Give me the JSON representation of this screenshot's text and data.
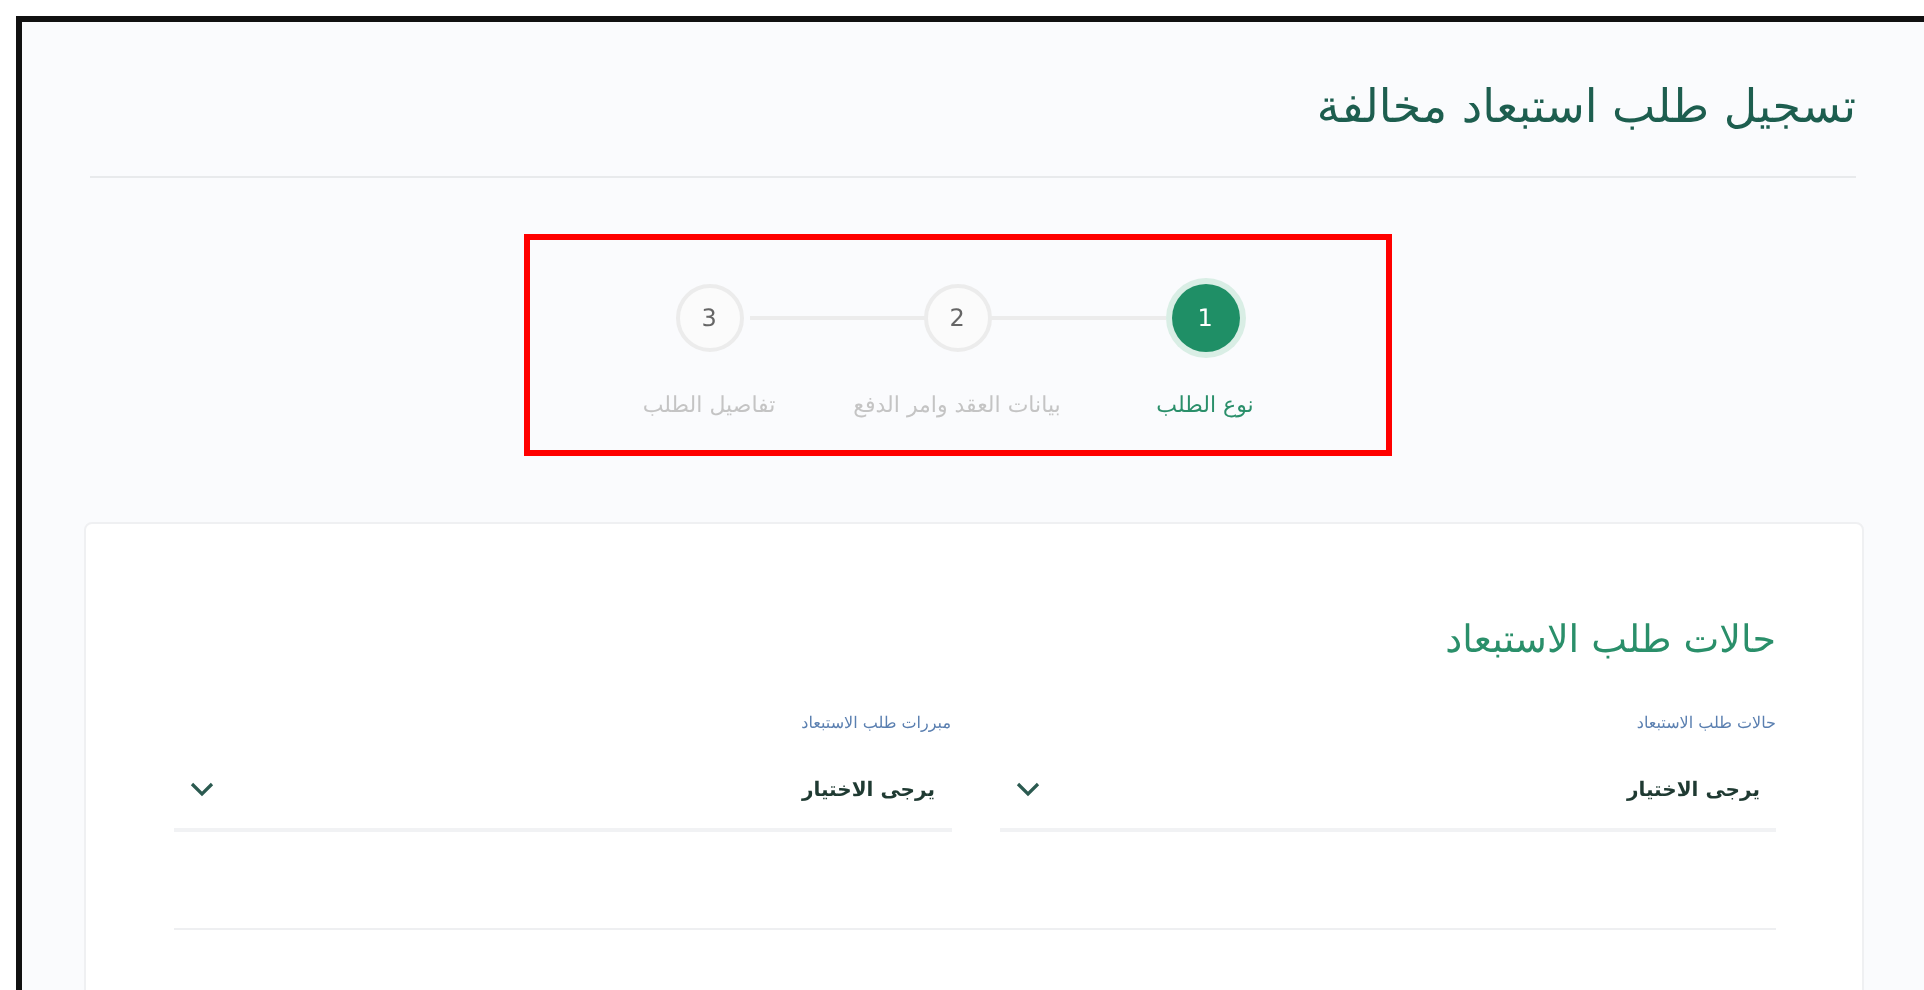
{
  "page_title": "تسجيل طلب استبعاد مخالفة",
  "steps": [
    {
      "number": "1",
      "label": "نوع الطلب",
      "selected": true
    },
    {
      "number": "2",
      "label": "بيانات العقد وامر الدفع",
      "selected": false
    },
    {
      "number": "3",
      "label": "تفاصيل الطلب",
      "selected": false
    }
  ],
  "card": {
    "heading": "حالات طلب الاستبعاد",
    "fields": [
      {
        "label": "حالات طلب الاستبعاد",
        "value": "يرجى الاختيار"
      },
      {
        "label": "مبررات طلب الاستبعاد",
        "value": "يرجى الاختيار"
      }
    ]
  }
}
